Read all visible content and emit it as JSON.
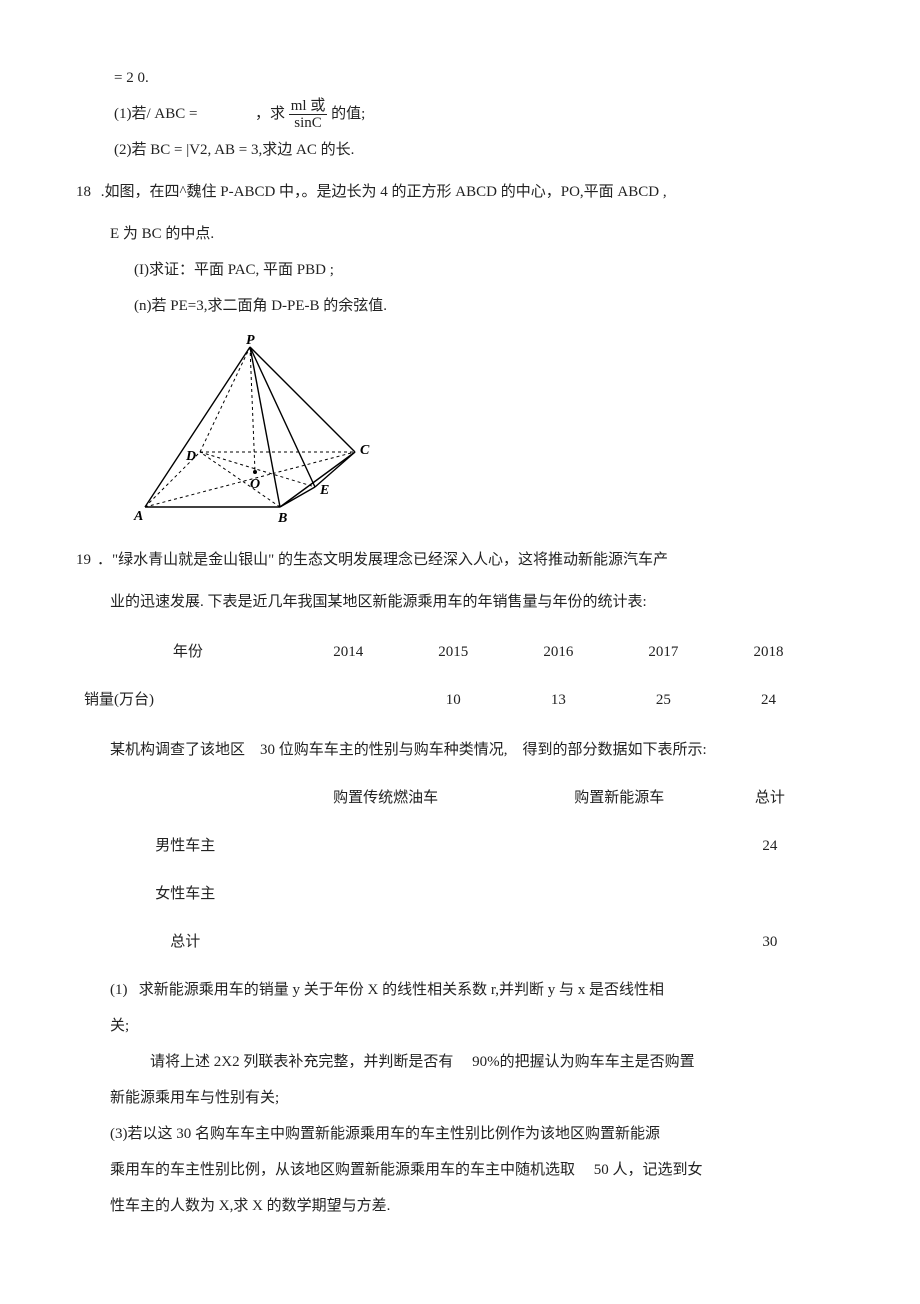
{
  "q17": {
    "eq": "= 2 0.",
    "p1_pre": "(1)若/ ABC =",
    "p1_mid": "，求",
    "p1_frac_top": "ml 或",
    "p1_frac_bot": "sinC",
    "p1_post": "的值;",
    "p2": "(2)若 BC = |V2,  AB = 3,求边 AC 的长."
  },
  "q18": {
    "num": "18",
    "stem1": " .如图，在四^魏住 P-ABCD 中，。是边长为 4 的正方形 ABCD 的中心，PO,平面 ABCD ,",
    "stem2": "E 为 BC 的中点.",
    "p1": "(I)求证：平面 PAC, 平面 PBD ;",
    "p2": "(n)若 PE=3,求二面角 D-PE-B 的余弦值.",
    "labels": {
      "P": "P",
      "A": "A",
      "B": "B",
      "C": "C",
      "D": "D",
      "E": "E",
      "O": "O"
    }
  },
  "q19": {
    "num": "19",
    "stem1": "．\"绿水青山就是金山银山\"    的生态文明发展理念已经深入人心，这将推动新能源汽车产",
    "stem2": "业的迅速发展. 下表是近几年我国某地区新能源乘用车的年销售量与年份的统计表:",
    "table1": {
      "h_year": "年份",
      "h_sales": "销量(万台)",
      "years": [
        "2014",
        "2015",
        "2016",
        "2017",
        "2018"
      ],
      "sales": [
        "",
        "10",
        "13",
        "25",
        "24"
      ]
    },
    "mid1_a": "某机构调查了该地区",
    "mid1_b": "30 位购车车主的性别与购车种类情况,",
    "mid1_c": "得到的部分数据如下表所示:",
    "table2": {
      "c1": "购置传统燃油车",
      "c2": "购置新能源车",
      "c3": "总计",
      "r1": "男性车主",
      "r1v": "24",
      "r2": "女性车主",
      "r3": "总计",
      "r3v": "30"
    },
    "p1_a": "(1)",
    "p1_b": "求新能源乘用车的销量    y 关于年份 X 的线性相关系数 r,并判断 y 与 x 是否线性相",
    "p1_c": "关;",
    "p2_a": "请将上述 2X2 列联表补充完整，并判断是否有",
    "p2_b": "90%的把握认为购车车主是否购置",
    "p2_c": "新能源乘用车与性别有关;",
    "p3_a": "(3)若以这 30 名购车车主中购置新能源乘用车的车主性别比例作为该地区购置新能源",
    "p3_b": "乘用车的车主性别比例，从该地区购置新能源乘用车的车主中随机选取",
    "p3_c": "50 人，记选到女",
    "p3_d": "性车主的人数为 X,求 X 的数学期望与方差."
  }
}
